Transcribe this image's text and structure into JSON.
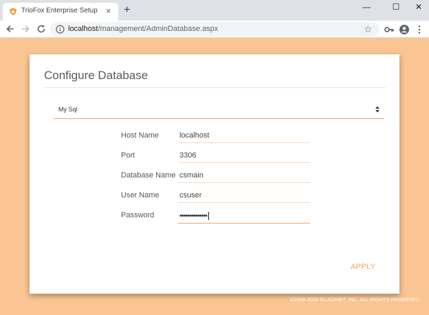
{
  "browser": {
    "tab_title": "TrioFox Enterprise Setup",
    "tab_close": "×",
    "new_tab": "+",
    "url_host": "localhost",
    "url_path": "/management/AdminDatabase.aspx",
    "window_controls": {
      "minimize": "—",
      "maximize": "☐",
      "close": "✕"
    }
  },
  "card": {
    "title": "Configure Database",
    "database_type": {
      "selected": "My Sql"
    },
    "fields": [
      {
        "label": "Host Name",
        "value": "localhost"
      },
      {
        "label": "Port",
        "value": "3306"
      },
      {
        "label": "Database Name",
        "value": "csmain"
      },
      {
        "label": "User Name",
        "value": "csuser"
      },
      {
        "label": "Password",
        "value": "••••••••••••••"
      }
    ],
    "apply_label": "APPLY"
  },
  "footer": {
    "copyright": "©2008-2020 GLADINET, INC. ALL RIGHTS RESERVED."
  },
  "colors": {
    "background": "#fbc593",
    "accent": "#f4a462",
    "card": "#ffffff"
  }
}
